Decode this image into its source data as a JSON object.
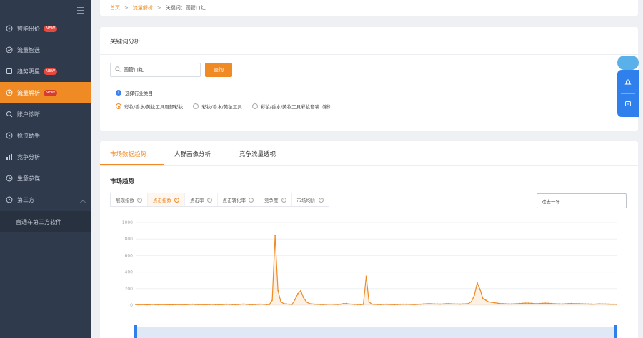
{
  "sidebar": {
    "items": [
      {
        "label": "智能出价",
        "icon": "bid-icon",
        "badge": "NEW"
      },
      {
        "label": "流量智选",
        "icon": "traffic-select-icon",
        "badge": ""
      },
      {
        "label": "趋势明星",
        "icon": "trend-star-icon",
        "badge": "NEW"
      },
      {
        "label": "流量解析",
        "icon": "traffic-analysis-icon",
        "badge": "NEW",
        "active": true
      },
      {
        "label": "账户诊断",
        "icon": "account-diagnosis-icon",
        "badge": ""
      },
      {
        "label": "抢位助手",
        "icon": "rank-assistant-icon",
        "badge": ""
      },
      {
        "label": "竞争分析",
        "icon": "competition-icon",
        "badge": ""
      },
      {
        "label": "生意参谋",
        "icon": "business-advisor-icon",
        "badge": ""
      },
      {
        "label": "第三方",
        "icon": "third-party-icon",
        "badge": ""
      }
    ],
    "sub_item": "直通车第三方软件"
  },
  "breadcrumb": {
    "home": "首页",
    "section": "流量解析",
    "current": "关键词：圆管口红"
  },
  "keyword_card": {
    "title": "关键词分析",
    "search_value": "圆管口红",
    "query_button": "查询",
    "industry_label": "选择行业类目",
    "categories": [
      {
        "label": "彩妆/香水/美妆工具眉部彩妆",
        "checked": true
      },
      {
        "label": "彩妆/香水/美妆工具",
        "checked": false
      },
      {
        "label": "彩妆/香水/美妆工具彩妆套装（新）",
        "checked": false
      }
    ]
  },
  "tabs": [
    "市场数据趋势",
    "人群画像分析",
    "竞争流量透视"
  ],
  "market": {
    "title": "市场趋势",
    "metrics": [
      {
        "label": "展现指数",
        "active": false
      },
      {
        "label": "点击指数",
        "active": true
      },
      {
        "label": "点击率",
        "active": false
      },
      {
        "label": "点击转化率",
        "active": false
      },
      {
        "label": "竞争度",
        "active": false
      },
      {
        "label": "市场均价",
        "active": false
      }
    ],
    "range": "过去一年"
  },
  "chart_data": {
    "type": "line",
    "ylim": [
      0,
      1000
    ],
    "yticks": [
      0,
      200,
      400,
      600,
      800,
      1000
    ],
    "series_color": "#f08a24",
    "series": [
      {
        "values": [
          8,
          6,
          9,
          7,
          5,
          8,
          10,
          7,
          6,
          9,
          8,
          7,
          5,
          6,
          8,
          9,
          7,
          6,
          8,
          10,
          12,
          9,
          8,
          7,
          6,
          8,
          9,
          10,
          8,
          7,
          6,
          9,
          11,
          10,
          8,
          7,
          9,
          12,
          14,
          10,
          8,
          7,
          9,
          11,
          13,
          10,
          8,
          9,
          60,
          840,
          180,
          40,
          20,
          15,
          12,
          10,
          70,
          140,
          175,
          90,
          40,
          20,
          15,
          12,
          10,
          9,
          8,
          10,
          12,
          11,
          10,
          9,
          12,
          18,
          20,
          15,
          12,
          10,
          9,
          8,
          10,
          350,
          40,
          12,
          10,
          9,
          8,
          10,
          11,
          9,
          8,
          7,
          9,
          10,
          12,
          11,
          10,
          9,
          8,
          10,
          12,
          14,
          16,
          18,
          17,
          15,
          14,
          13,
          15,
          17,
          18,
          16,
          15,
          14,
          13,
          15,
          16,
          20,
          45,
          120,
          270,
          190,
          80,
          60,
          40,
          35,
          30,
          25,
          20,
          18,
          16,
          15,
          14,
          16,
          18,
          20,
          22,
          25,
          24,
          22,
          20,
          18,
          20,
          22,
          24,
          22,
          20,
          18,
          16,
          15,
          14,
          16,
          18,
          20,
          19,
          18,
          17,
          16,
          15,
          14,
          13,
          12,
          14,
          16,
          15,
          14,
          13,
          12,
          11,
          10
        ]
      }
    ]
  }
}
